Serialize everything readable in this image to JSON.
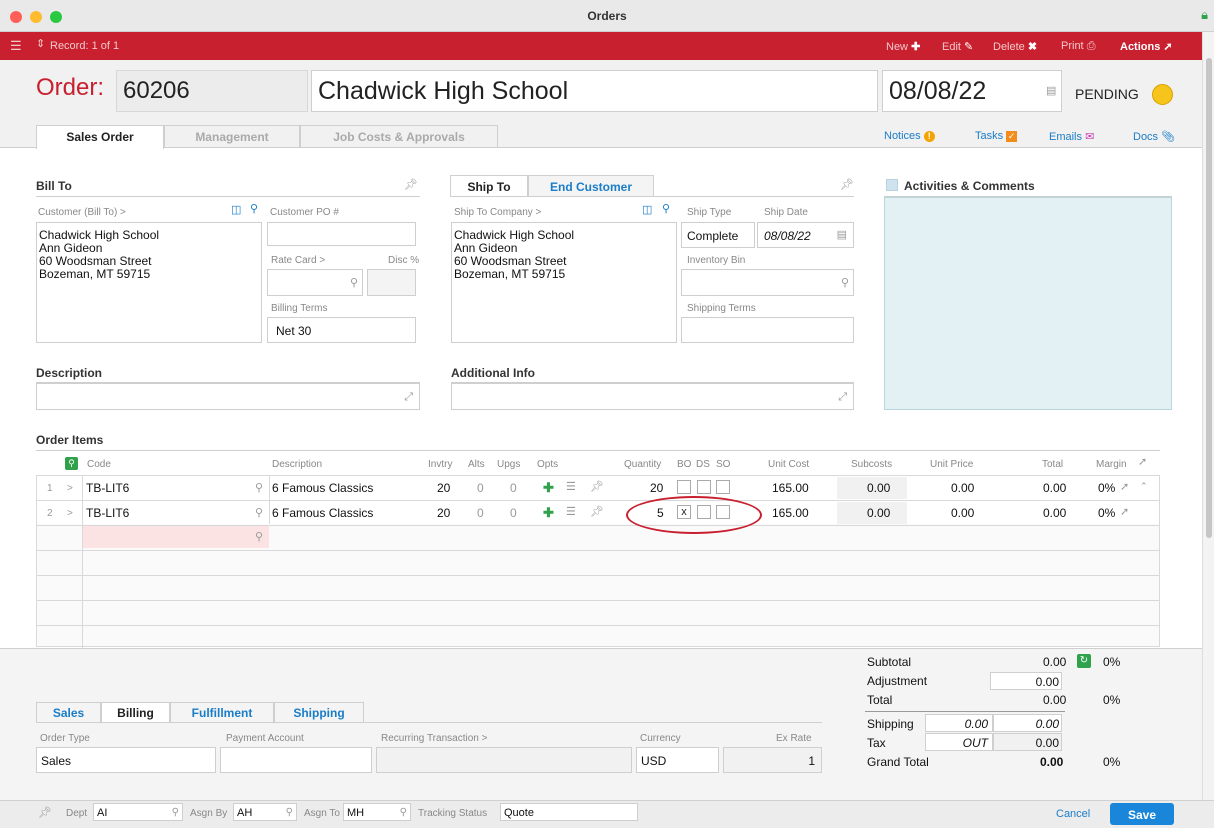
{
  "window": {
    "title": "Orders"
  },
  "toolbar": {
    "record": "Record: 1 of 1",
    "new_label": "New",
    "edit_label": "Edit",
    "delete_label": "Delete",
    "print_label": "Print",
    "actions_label": "Actions"
  },
  "header": {
    "order_label": "Order:",
    "order_number": "60206",
    "customer_name": "Chadwick High School",
    "order_date": "08/08/22",
    "status": "PENDING"
  },
  "tabs": [
    {
      "label": "Sales Order",
      "active": true
    },
    {
      "label": "Management",
      "active": false
    },
    {
      "label": "Job Costs & Approvals",
      "active": false
    }
  ],
  "links": {
    "notices": "Notices",
    "tasks": "Tasks",
    "emails": "Emails",
    "docs": "Docs"
  },
  "bill_to": {
    "title": "Bill To",
    "customer_label": "Customer (Bill To) >",
    "address": [
      "Chadwick High School",
      "Ann Gideon",
      "60 Woodsman Street",
      "Bozeman, MT 59715"
    ],
    "customer_po_label": "Customer PO #",
    "customer_po": "",
    "rate_card_label": "Rate Card >",
    "disc_label": "Disc %",
    "billing_terms_label": "Billing Terms",
    "billing_terms": "Net 30"
  },
  "ship_to": {
    "tab_ship_to": "Ship To",
    "tab_end_customer": "End Customer",
    "company_label": "Ship To Company >",
    "address": [
      "Chadwick High School",
      "Ann Gideon",
      "60 Woodsman Street",
      "Bozeman, MT 59715"
    ],
    "ship_type_label": "Ship Type",
    "ship_type": "Complete",
    "ship_date_label": "Ship Date",
    "ship_date": "08/08/22",
    "inventory_bin_label": "Inventory Bin",
    "shipping_terms_label": "Shipping Terms"
  },
  "activities": {
    "title": "Activities & Comments"
  },
  "description": {
    "title": "Description"
  },
  "additional_info": {
    "title": "Additional Info"
  },
  "order_items": {
    "title": "Order Items",
    "columns": {
      "code": "Code",
      "description": "Description",
      "invtry": "Invtry",
      "alts": "Alts",
      "upgs": "Upgs",
      "opts": "Opts",
      "quantity": "Quantity",
      "bo": "BO",
      "ds": "DS",
      "so": "SO",
      "unit_cost": "Unit Cost",
      "subcosts": "Subcosts",
      "unit_price": "Unit Price",
      "total": "Total",
      "margin": "Margin"
    },
    "rows": [
      {
        "num": "1",
        "code": "TB-LIT6",
        "description": "6 Famous Classics",
        "invtry": "20",
        "alts": "0",
        "upgs": "0",
        "quantity": "20",
        "bo": "",
        "unit_cost": "165.00",
        "subcosts": "0.00",
        "unit_price": "0.00",
        "total": "0.00",
        "margin": "0%"
      },
      {
        "num": "2",
        "code": "TB-LIT6",
        "description": "6 Famous Classics",
        "invtry": "20",
        "alts": "0",
        "upgs": "0",
        "quantity": "5",
        "bo": "x",
        "unit_cost": "165.00",
        "subcosts": "0.00",
        "unit_price": "0.00",
        "total": "0.00",
        "margin": "0%"
      }
    ]
  },
  "bottom_tabs": [
    {
      "label": "Sales",
      "active": false
    },
    {
      "label": "Billing",
      "active": true
    },
    {
      "label": "Fulfillment",
      "active": false
    },
    {
      "label": "Shipping",
      "active": false
    }
  ],
  "billing": {
    "order_type_label": "Order Type",
    "order_type": "Sales",
    "payment_account_label": "Payment Account",
    "recurring_label": "Recurring Transaction >",
    "currency_label": "Currency",
    "currency": "USD",
    "ex_rate_label": "Ex Rate",
    "ex_rate": "1"
  },
  "totals": {
    "subtotal_label": "Subtotal",
    "subtotal": "0.00",
    "subtotal_pct": "0%",
    "adjustment_label": "Adjustment",
    "adjustment": "0.00",
    "total_label": "Total",
    "total": "0.00",
    "total_pct": "0%",
    "shipping_label": "Shipping",
    "shipping_rate": "0.00",
    "shipping": "0.00",
    "tax_label": "Tax",
    "tax_code": "OUT",
    "tax": "0.00",
    "grand_total_label": "Grand Total",
    "grand_total": "0.00",
    "grand_total_pct": "0%"
  },
  "footer": {
    "dept_label": "Dept",
    "dept": "AI",
    "asgn_by_label": "Asgn By",
    "asgn_by": "AH",
    "asgn_to_label": "Asgn To",
    "asgn_to": "MH",
    "tracking_label": "Tracking Status",
    "tracking": "Quote",
    "cancel_label": "Cancel",
    "save_label": "Save"
  },
  "colors": {
    "accent": "#c8202f",
    "link": "#1a7dc8",
    "status": "#f7c41c",
    "save": "#1a86d9"
  }
}
